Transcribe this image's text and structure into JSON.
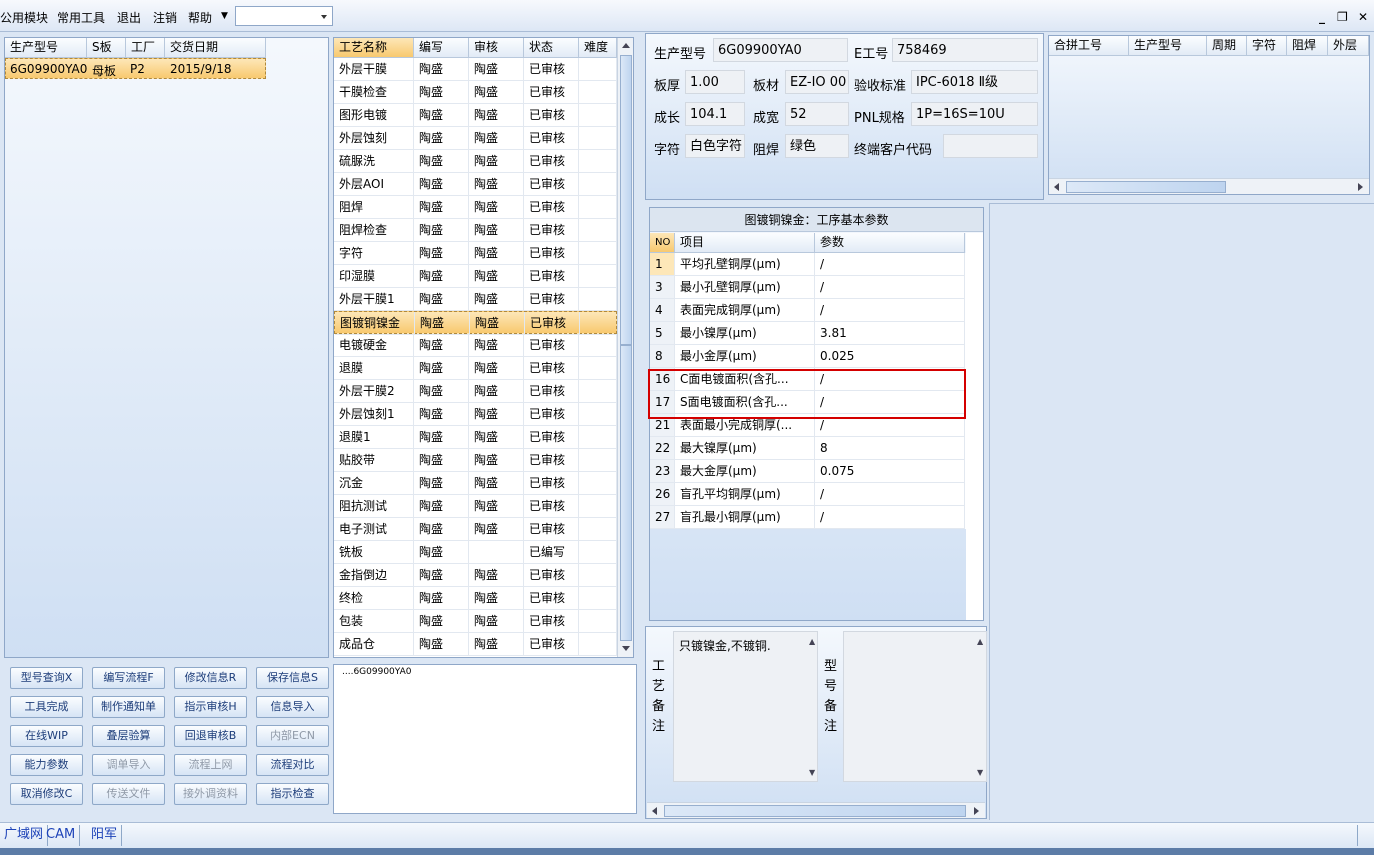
{
  "menu": {
    "items": [
      "公用模块",
      "常用工具",
      "退出",
      "注销",
      "帮助"
    ]
  },
  "window_controls": {
    "minimize": "_",
    "restore": "❐",
    "close": "✕"
  },
  "model_grid": {
    "headers": [
      "生产型号",
      "S板",
      "工厂",
      "交货日期"
    ],
    "rows": [
      [
        "6G09900YA0",
        "母板",
        "P2",
        "2015/9/18"
      ]
    ]
  },
  "process_grid": {
    "headers": [
      "工艺名称",
      "编写",
      "审核",
      "状态",
      "难度"
    ],
    "rows": [
      [
        "外层干膜",
        "陶盛",
        "陶盛",
        "已审核",
        ""
      ],
      [
        "干膜检查",
        "陶盛",
        "陶盛",
        "已审核",
        ""
      ],
      [
        "图形电镀",
        "陶盛",
        "陶盛",
        "已审核",
        ""
      ],
      [
        "外层蚀刻",
        "陶盛",
        "陶盛",
        "已审核",
        ""
      ],
      [
        "硫脲洗",
        "陶盛",
        "陶盛",
        "已审核",
        ""
      ],
      [
        "外层AOI",
        "陶盛",
        "陶盛",
        "已审核",
        ""
      ],
      [
        "阻焊",
        "陶盛",
        "陶盛",
        "已审核",
        ""
      ],
      [
        "阻焊检查",
        "陶盛",
        "陶盛",
        "已审核",
        ""
      ],
      [
        "字符",
        "陶盛",
        "陶盛",
        "已审核",
        ""
      ],
      [
        "印湿膜",
        "陶盛",
        "陶盛",
        "已审核",
        ""
      ],
      [
        "外层干膜1",
        "陶盛",
        "陶盛",
        "已审核",
        ""
      ],
      [
        "图镀铜镍金",
        "陶盛",
        "陶盛",
        "已审核",
        ""
      ],
      [
        "电镀硬金",
        "陶盛",
        "陶盛",
        "已审核",
        ""
      ],
      [
        "退膜",
        "陶盛",
        "陶盛",
        "已审核",
        ""
      ],
      [
        "外层干膜2",
        "陶盛",
        "陶盛",
        "已审核",
        ""
      ],
      [
        "外层蚀刻1",
        "陶盛",
        "陶盛",
        "已审核",
        ""
      ],
      [
        "退膜1",
        "陶盛",
        "陶盛",
        "已审核",
        ""
      ],
      [
        "贴胶带",
        "陶盛",
        "陶盛",
        "已审核",
        ""
      ],
      [
        "沉金",
        "陶盛",
        "陶盛",
        "已审核",
        ""
      ],
      [
        "阻抗测试",
        "陶盛",
        "陶盛",
        "已审核",
        ""
      ],
      [
        "电子测试",
        "陶盛",
        "陶盛",
        "已审核",
        ""
      ],
      [
        "铣板",
        "陶盛",
        "",
        "已编写",
        ""
      ],
      [
        "金指倒边",
        "陶盛",
        "陶盛",
        "已审核",
        ""
      ],
      [
        "终检",
        "陶盛",
        "陶盛",
        "已审核",
        ""
      ],
      [
        "包装",
        "陶盛",
        "陶盛",
        "已审核",
        ""
      ],
      [
        "成品仓",
        "陶盛",
        "陶盛",
        "已审核",
        ""
      ]
    ],
    "selected_index": 11
  },
  "buttons": [
    [
      "型号查询X",
      "编写流程F",
      "修改信息R",
      "保存信息S"
    ],
    [
      "工具完成",
      "制作通知单",
      "指示审核H",
      "信息导入"
    ],
    [
      "在线WIP",
      "叠层验算",
      "回退审核B",
      "内部ECN"
    ],
    [
      "能力参数",
      "调单导入",
      "流程上网",
      "流程对比"
    ],
    [
      "取消修改C",
      "传送文件",
      "接外调资料",
      "指示检查"
    ]
  ],
  "disabled_buttons": [
    "内部ECN",
    "调单导入",
    "流程上网",
    "传送文件",
    "接外调资料"
  ],
  "log": {
    "text": "....6G09900YA0"
  },
  "info": {
    "production_model_label": "生产型号",
    "production_model": "6G09900YA0",
    "e_number_label": "E工号",
    "e_number": "758469",
    "thickness_label": "板厚",
    "thickness": "1.00",
    "material_label": "板材",
    "material": "EZ-IO 00",
    "standard_label": "验收标准",
    "standard": "IPC-6018 Ⅱ级",
    "length_label": "成长",
    "length": "104.1",
    "width_label": "成宽",
    "width": "52",
    "pnl_label": "PNL规格",
    "pnl": "1P=16S=10U",
    "char_label": "字符",
    "char": "白色字符",
    "mask_label": "阻焊",
    "mask": "绿色",
    "customer_label": "终端客户代码",
    "customer": ""
  },
  "joint_grid": {
    "headers": [
      "合拼工号",
      "生产型号",
      "周期",
      "字符",
      "阻焊",
      "外层"
    ]
  },
  "params": {
    "title": "图镀铜镍金：工序基本参数",
    "headers": [
      "NO",
      "项目",
      "参数"
    ],
    "rows": [
      [
        "1",
        "平均孔壁铜厚(μm)",
        "/"
      ],
      [
        "3",
        "最小孔壁铜厚(μm)",
        "/"
      ],
      [
        "4",
        "表面完成铜厚(μm)",
        "/"
      ],
      [
        "5",
        "最小镍厚(μm)",
        "3.81"
      ],
      [
        "8",
        "最小金厚(μm)",
        "0.025"
      ],
      [
        "16",
        "C面电镀面积(含孔...",
        "/"
      ],
      [
        "17",
        "S面电镀面积(含孔...",
        "/"
      ],
      [
        "21",
        "表面最小完成铜厚(...",
        "/"
      ],
      [
        "22",
        "最大镍厚(μm)",
        "8"
      ],
      [
        "23",
        "最大金厚(μm)",
        "0.075"
      ],
      [
        "26",
        "盲孔平均铜厚(μm)",
        "/"
      ],
      [
        "27",
        "盲孔最小铜厚(μm)",
        "/"
      ]
    ]
  },
  "notes": {
    "process_label": "工艺备注",
    "process_text": "只镀镍金,不镀铜.",
    "model_label": "型号备注",
    "model_text": ""
  },
  "status": {
    "items": [
      "广域网",
      "CAM",
      "阳军"
    ]
  },
  "colors": {
    "highlight": "#d40000",
    "selection": "#f8c96f",
    "accent": "#1d43b8"
  }
}
